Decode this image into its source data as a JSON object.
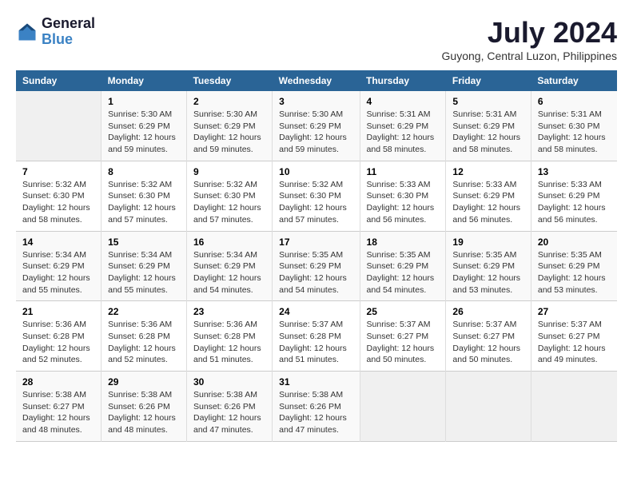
{
  "header": {
    "logo_line1": "General",
    "logo_line2": "Blue",
    "month_year": "July 2024",
    "location": "Guyong, Central Luzon, Philippines"
  },
  "weekdays": [
    "Sunday",
    "Monday",
    "Tuesday",
    "Wednesday",
    "Thursday",
    "Friday",
    "Saturday"
  ],
  "weeks": [
    [
      {
        "day": "",
        "content": ""
      },
      {
        "day": "1",
        "content": "Sunrise: 5:30 AM\nSunset: 6:29 PM\nDaylight: 12 hours\nand 59 minutes."
      },
      {
        "day": "2",
        "content": "Sunrise: 5:30 AM\nSunset: 6:29 PM\nDaylight: 12 hours\nand 59 minutes."
      },
      {
        "day": "3",
        "content": "Sunrise: 5:30 AM\nSunset: 6:29 PM\nDaylight: 12 hours\nand 59 minutes."
      },
      {
        "day": "4",
        "content": "Sunrise: 5:31 AM\nSunset: 6:29 PM\nDaylight: 12 hours\nand 58 minutes."
      },
      {
        "day": "5",
        "content": "Sunrise: 5:31 AM\nSunset: 6:29 PM\nDaylight: 12 hours\nand 58 minutes."
      },
      {
        "day": "6",
        "content": "Sunrise: 5:31 AM\nSunset: 6:30 PM\nDaylight: 12 hours\nand 58 minutes."
      }
    ],
    [
      {
        "day": "7",
        "content": "Sunrise: 5:32 AM\nSunset: 6:30 PM\nDaylight: 12 hours\nand 58 minutes."
      },
      {
        "day": "8",
        "content": "Sunrise: 5:32 AM\nSunset: 6:30 PM\nDaylight: 12 hours\nand 57 minutes."
      },
      {
        "day": "9",
        "content": "Sunrise: 5:32 AM\nSunset: 6:30 PM\nDaylight: 12 hours\nand 57 minutes."
      },
      {
        "day": "10",
        "content": "Sunrise: 5:32 AM\nSunset: 6:30 PM\nDaylight: 12 hours\nand 57 minutes."
      },
      {
        "day": "11",
        "content": "Sunrise: 5:33 AM\nSunset: 6:30 PM\nDaylight: 12 hours\nand 56 minutes."
      },
      {
        "day": "12",
        "content": "Sunrise: 5:33 AM\nSunset: 6:29 PM\nDaylight: 12 hours\nand 56 minutes."
      },
      {
        "day": "13",
        "content": "Sunrise: 5:33 AM\nSunset: 6:29 PM\nDaylight: 12 hours\nand 56 minutes."
      }
    ],
    [
      {
        "day": "14",
        "content": "Sunrise: 5:34 AM\nSunset: 6:29 PM\nDaylight: 12 hours\nand 55 minutes."
      },
      {
        "day": "15",
        "content": "Sunrise: 5:34 AM\nSunset: 6:29 PM\nDaylight: 12 hours\nand 55 minutes."
      },
      {
        "day": "16",
        "content": "Sunrise: 5:34 AM\nSunset: 6:29 PM\nDaylight: 12 hours\nand 54 minutes."
      },
      {
        "day": "17",
        "content": "Sunrise: 5:35 AM\nSunset: 6:29 PM\nDaylight: 12 hours\nand 54 minutes."
      },
      {
        "day": "18",
        "content": "Sunrise: 5:35 AM\nSunset: 6:29 PM\nDaylight: 12 hours\nand 54 minutes."
      },
      {
        "day": "19",
        "content": "Sunrise: 5:35 AM\nSunset: 6:29 PM\nDaylight: 12 hours\nand 53 minutes."
      },
      {
        "day": "20",
        "content": "Sunrise: 5:35 AM\nSunset: 6:29 PM\nDaylight: 12 hours\nand 53 minutes."
      }
    ],
    [
      {
        "day": "21",
        "content": "Sunrise: 5:36 AM\nSunset: 6:28 PM\nDaylight: 12 hours\nand 52 minutes."
      },
      {
        "day": "22",
        "content": "Sunrise: 5:36 AM\nSunset: 6:28 PM\nDaylight: 12 hours\nand 52 minutes."
      },
      {
        "day": "23",
        "content": "Sunrise: 5:36 AM\nSunset: 6:28 PM\nDaylight: 12 hours\nand 51 minutes."
      },
      {
        "day": "24",
        "content": "Sunrise: 5:37 AM\nSunset: 6:28 PM\nDaylight: 12 hours\nand 51 minutes."
      },
      {
        "day": "25",
        "content": "Sunrise: 5:37 AM\nSunset: 6:27 PM\nDaylight: 12 hours\nand 50 minutes."
      },
      {
        "day": "26",
        "content": "Sunrise: 5:37 AM\nSunset: 6:27 PM\nDaylight: 12 hours\nand 50 minutes."
      },
      {
        "day": "27",
        "content": "Sunrise: 5:37 AM\nSunset: 6:27 PM\nDaylight: 12 hours\nand 49 minutes."
      }
    ],
    [
      {
        "day": "28",
        "content": "Sunrise: 5:38 AM\nSunset: 6:27 PM\nDaylight: 12 hours\nand 48 minutes."
      },
      {
        "day": "29",
        "content": "Sunrise: 5:38 AM\nSunset: 6:26 PM\nDaylight: 12 hours\nand 48 minutes."
      },
      {
        "day": "30",
        "content": "Sunrise: 5:38 AM\nSunset: 6:26 PM\nDaylight: 12 hours\nand 47 minutes."
      },
      {
        "day": "31",
        "content": "Sunrise: 5:38 AM\nSunset: 6:26 PM\nDaylight: 12 hours\nand 47 minutes."
      },
      {
        "day": "",
        "content": ""
      },
      {
        "day": "",
        "content": ""
      },
      {
        "day": "",
        "content": ""
      }
    ]
  ]
}
